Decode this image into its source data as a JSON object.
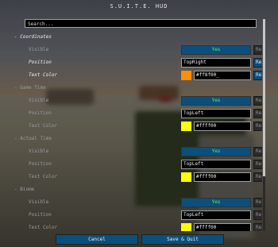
{
  "title": "S.U.I.T.E. HUD",
  "search": {
    "placeholder": "Search..."
  },
  "sections": [
    {
      "name": "Coordinates",
      "active": true,
      "rows": [
        {
          "label": "Visible",
          "type": "toggle",
          "value": "Yes",
          "reset": "Reset"
        },
        {
          "label": "Position",
          "type": "text",
          "value": "TopRight",
          "reset": "Reset"
        },
        {
          "label": "Text Color",
          "type": "color",
          "value": "#ff8f00_",
          "swatch": "#ff8f00",
          "reset": "Reset"
        }
      ]
    },
    {
      "name": "Game Time",
      "active": false,
      "rows": [
        {
          "label": "Visible",
          "type": "toggle",
          "value": "Yes",
          "reset": "Reset"
        },
        {
          "label": "Position",
          "type": "text",
          "value": "TopLeft",
          "reset": "Reset"
        },
        {
          "label": "Text Color",
          "type": "color",
          "value": "#ffff00",
          "swatch": "#ffff00",
          "reset": "Reset"
        }
      ]
    },
    {
      "name": "Actual Time",
      "active": false,
      "rows": [
        {
          "label": "Visible",
          "type": "toggle",
          "value": "Yes",
          "reset": "Reset"
        },
        {
          "label": "Position",
          "type": "text",
          "value": "TopLeft",
          "reset": "Reset"
        },
        {
          "label": "Text Color",
          "type": "color",
          "value": "#ffff00",
          "swatch": "#ffff00",
          "reset": "Reset"
        }
      ]
    },
    {
      "name": "Biome",
      "active": false,
      "rows": [
        {
          "label": "Visible",
          "type": "toggle",
          "value": "Yes",
          "reset": "Reset"
        },
        {
          "label": "Position",
          "type": "text",
          "value": "TopLeft",
          "reset": "Reset"
        },
        {
          "label": "Text Color",
          "type": "color",
          "value": "#ffff00",
          "swatch": "#ffff00",
          "reset": "Reset"
        }
      ]
    }
  ],
  "buttons": {
    "cancel": "Cancel",
    "save": "Save & Quit"
  },
  "colors": {
    "button_blue": "#0b4f7c",
    "yes_green": "#5ff05f",
    "accent_orange": "#ff8f00",
    "accent_yellow": "#ffff00"
  }
}
